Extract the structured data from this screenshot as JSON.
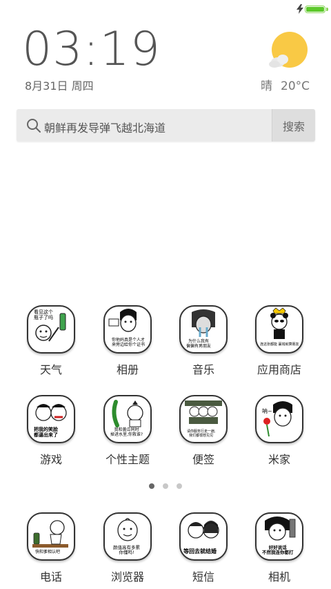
{
  "status": {
    "battery_percent": 100,
    "charging": true
  },
  "clock": {
    "time": "03:19",
    "date": "8月31日 周四"
  },
  "weather": {
    "condition": "晴",
    "temperature": "20°C",
    "icon": "sunny-cloud-icon"
  },
  "search": {
    "query": "朝鲜再发导弹飞越北海道",
    "button_label": "搜索"
  },
  "apps_grid": [
    {
      "label": "天气",
      "meme": "看见这个\n瓶子了吗"
    },
    {
      "label": "相册",
      "meme": "你他妈真是个人才\n来旁边给你个证书"
    },
    {
      "label": "音乐",
      "meme": "为什么我有\n偏偏有男朋友"
    },
    {
      "label": "应用商店",
      "meme": "连这张都能 赢钱就算朋友"
    },
    {
      "label": "游戏",
      "meme": "把我的笑脸\n都逼出来了"
    },
    {
      "label": "个性主题",
      "meme": "我和黄瓜同时\n掉进水里,你救谁?"
    },
    {
      "label": "便签",
      "meme": "请你服务行走一趟,\n我们都很想见见"
    },
    {
      "label": "米家",
      "meme": "呐~"
    }
  ],
  "page_indicator": {
    "count": 3,
    "active": 0
  },
  "dock": [
    {
      "label": "电话",
      "meme": "快和爹相认吧"
    },
    {
      "label": "浏览器",
      "meme": "颜值高有多累\n你懂吗!"
    },
    {
      "label": "短信",
      "meme": "等回去就结婚"
    },
    {
      "label": "相机",
      "meme": "好好说话\n不然我连你都打"
    }
  ],
  "colors": {
    "battery": "#5cc82b",
    "sun": "#f9c945",
    "text": "#333333"
  }
}
